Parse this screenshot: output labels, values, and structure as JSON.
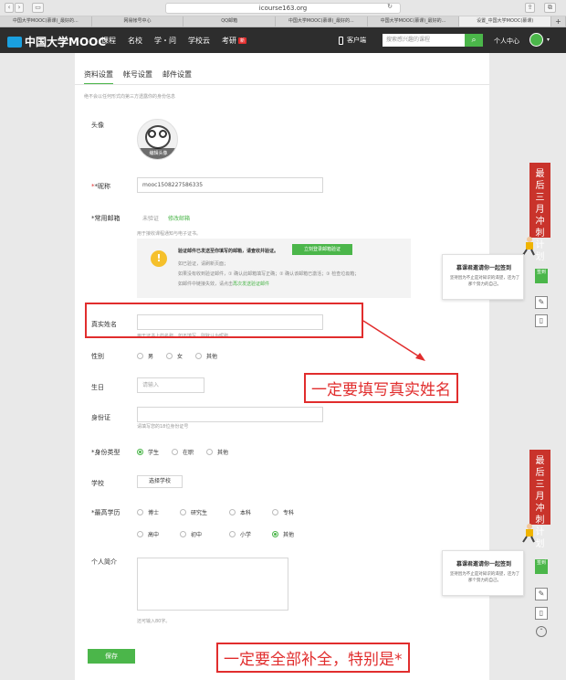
{
  "browser": {
    "url": "icourse163.org",
    "tabs": [
      {
        "label": "中国大学MOOC(慕课)_最好的..."
      },
      {
        "label": "网易帐号中心"
      },
      {
        "label": "QQ邮箱"
      },
      {
        "label": "中国大学MOOC(慕课)_最好的..."
      },
      {
        "label": "中国大学MOOC(慕课)_最好的..."
      },
      {
        "label": "设置_中国大学MOOC(慕课)"
      }
    ],
    "new_tab": "+"
  },
  "header": {
    "logo": "中国大学MOOC",
    "nav": [
      "课程",
      "名校",
      "学・问",
      "学校云",
      "考研"
    ],
    "new_badge": "新",
    "app_link": "客户端",
    "search_placeholder": "搜索感兴趣的课程",
    "search_icon": "search-icon",
    "personal_center": "个人中心"
  },
  "settings": {
    "tabs": [
      "资料设置",
      "帐号设置",
      "邮件设置"
    ],
    "active_tab": 0,
    "privacy_note": "绝不会以任何形式向第三方透露你的身份信息",
    "avatar": {
      "label": "头像",
      "edit": "编辑头像"
    },
    "nickname": {
      "label": "*昵称",
      "value": "mooc1508227586335"
    },
    "email": {
      "label": "*常用邮箱",
      "status": "未验证",
      "modify": "修改邮箱",
      "hint": "用于接收课程通知与电子证书。",
      "verify_title": "验证邮件已发送至你填写的邮箱，请查收并验证。",
      "verify_button": "立刻登录邮箱验证",
      "verify_lines": [
        "如已验证，请刷新页面；",
        "如果没有收到验证邮件，① 确认此邮箱填写正确；② 确认该邮箱已激活；③ 检查垃圾箱；",
        "如邮件中链接失效，请点击"
      ],
      "resend": "再次发送验证邮件"
    },
    "real_name": {
      "label": "真实姓名",
      "value": "",
      "hint": "用于证书上的名称，如不填写，则默认为昵称"
    },
    "gender": {
      "label": "性别",
      "options": [
        "男",
        "女",
        "其他"
      ],
      "selected": -1
    },
    "birthday": {
      "label": "生日",
      "placeholder": "请输入"
    },
    "id_card": {
      "label": "身份证",
      "hint": "请填写您的18位身份证号"
    },
    "identity": {
      "label": "*身份类型",
      "options": [
        "学生",
        "在职",
        "其他"
      ],
      "selected": 0
    },
    "school": {
      "label": "学校",
      "button": "选择学校"
    },
    "education": {
      "label": "*最高学历",
      "row1": [
        "博士",
        "研究生",
        "本科",
        "专科"
      ],
      "row2": [
        "高中",
        "初中",
        "小学",
        "其他"
      ],
      "selected": "其他"
    },
    "bio": {
      "label": "个人简介",
      "hint": "还可输入80字。"
    },
    "save": "保存"
  },
  "annotations": {
    "callout1": "一定要填写真实姓名",
    "callout2": "一定要全部补全，特别是*",
    "color": "#e12d2d"
  },
  "side": {
    "banner1": "最后三月冲刺计划",
    "banner2": "最后三月冲刺计划",
    "invite_title": "慕课君邀请你一起签到",
    "invite_text": "坚持因为不止是对知识的渴望，还为了那个努力的自己。",
    "signin": "签到",
    "edit_icon": "edit-icon",
    "mobile_icon": "mobile-icon",
    "top_icon": "back-to-top-icon"
  }
}
